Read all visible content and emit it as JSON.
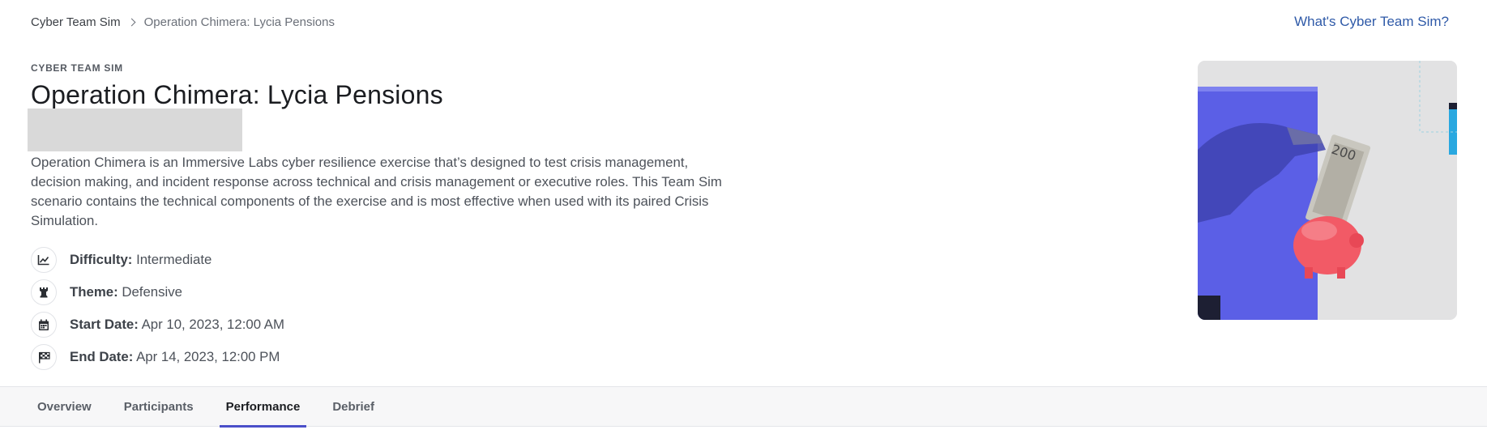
{
  "breadcrumb": {
    "root": "Cyber Team Sim",
    "current": "Operation Chimera: Lycia Pensions",
    "separator_icon": "chevron-right-icon"
  },
  "header_link": "What's Cyber Team Sim?",
  "eyebrow": "CYBER TEAM SIM",
  "title": "Operation Chimera: Lycia Pensions",
  "description": "Operation Chimera is an Immersive Labs cyber resilience exercise that’s designed to test crisis management, decision making, and incident response across technical and crisis management or executive roles. This Team Sim scenario contains the technical components of the exercise and is most effective when used with its paired Crisis Simulation.",
  "meta": [
    {
      "icon": "chart-line-icon",
      "label": "Difficulty:",
      "value": "Intermediate"
    },
    {
      "icon": "chess-rook-icon",
      "label": "Theme:",
      "value": "Defensive"
    },
    {
      "icon": "calendar-icon",
      "label": "Start Date:",
      "value": "Apr 10, 2023, 12:00 AM"
    },
    {
      "icon": "checkered-flag-icon",
      "label": "End Date:",
      "value": "Apr 14, 2023, 12:00 PM"
    }
  ],
  "hero_image": "hand-inserting-banknotes-into-red-piggy-bank",
  "tabs": [
    {
      "label": "Overview",
      "active": false
    },
    {
      "label": "Participants",
      "active": false
    },
    {
      "label": "Performance",
      "active": true
    },
    {
      "label": "Debrief",
      "active": false
    }
  ],
  "colors": {
    "accent": "#4a4fc9",
    "link": "#2f5aa8",
    "hero_blue": "#5b5fe6",
    "hero_pink": "#f25a66",
    "hero_cyan": "#29a8e0"
  }
}
